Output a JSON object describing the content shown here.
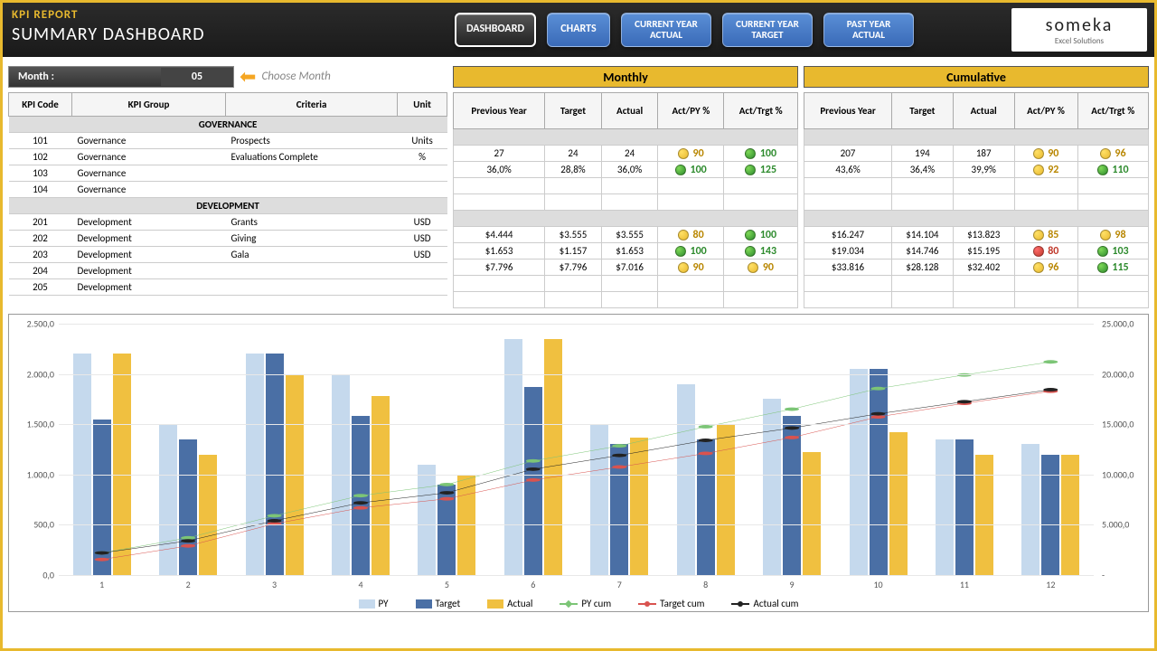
{
  "header": {
    "kpi_label": "KPI REPORT",
    "title": "SUMMARY DASHBOARD",
    "nav": {
      "dashboard": "DASHBOARD",
      "charts": "CHARTS",
      "cy_actual_l1": "CURRENT YEAR",
      "cy_actual_l2": "ACTUAL",
      "cy_target_l1": "CURRENT YEAR",
      "cy_target_l2": "TARGET",
      "py_actual_l1": "PAST YEAR",
      "py_actual_l2": "ACTUAL"
    },
    "logo": "someka",
    "logo_sub": "Excel Solutions"
  },
  "month": {
    "label": "Month :",
    "value": "05",
    "hint": "Choose Month"
  },
  "left_headers": {
    "code": "KPI Code",
    "group": "KPI Group",
    "criteria": "Criteria",
    "unit": "Unit"
  },
  "groups": {
    "gov": "GOVERNANCE",
    "dev": "DEVELOPMENT"
  },
  "rows_gov": [
    {
      "code": "101",
      "group": "Governance",
      "criteria": "Prospects",
      "unit": "Units"
    },
    {
      "code": "102",
      "group": "Governance",
      "criteria": "Evaluations Complete",
      "unit": "%"
    },
    {
      "code": "103",
      "group": "Governance",
      "criteria": "",
      "unit": ""
    },
    {
      "code": "104",
      "group": "Governance",
      "criteria": "",
      "unit": ""
    }
  ],
  "rows_dev": [
    {
      "code": "201",
      "group": "Development",
      "criteria": "Grants",
      "unit": "USD"
    },
    {
      "code": "202",
      "group": "Development",
      "criteria": "Giving",
      "unit": "USD"
    },
    {
      "code": "203",
      "group": "Development",
      "criteria": "Gala",
      "unit": "USD"
    },
    {
      "code": "204",
      "group": "Development",
      "criteria": "",
      "unit": ""
    },
    {
      "code": "205",
      "group": "Development",
      "criteria": "",
      "unit": ""
    }
  ],
  "section_titles": {
    "monthly": "Monthly",
    "cumulative": "Cumulative"
  },
  "val_headers": {
    "py": "Previous Year",
    "target": "Target",
    "actual": "Actual",
    "act_py": "Act/PY %",
    "act_tgt": "Act/Trgt %"
  },
  "monthly_gov": [
    {
      "py": "27",
      "target": "24",
      "actual": "24",
      "act_py": "90",
      "act_py_c": "yellow",
      "act_tgt": "100",
      "act_tgt_c": "green"
    },
    {
      "py": "36,0%",
      "target": "28,8%",
      "actual": "36,0%",
      "act_py": "100",
      "act_py_c": "green",
      "act_tgt": "125",
      "act_tgt_c": "green"
    },
    {
      "py": "",
      "target": "",
      "actual": "",
      "act_py": "",
      "act_tgt": ""
    },
    {
      "py": "",
      "target": "",
      "actual": "",
      "act_py": "",
      "act_tgt": ""
    }
  ],
  "monthly_dev": [
    {
      "py": "$4.444",
      "target": "$3.555",
      "actual": "$3.555",
      "act_py": "80",
      "act_py_c": "yellow",
      "act_tgt": "100",
      "act_tgt_c": "green"
    },
    {
      "py": "$1.653",
      "target": "$1.157",
      "actual": "$1.653",
      "act_py": "100",
      "act_py_c": "green",
      "act_tgt": "143",
      "act_tgt_c": "green"
    },
    {
      "py": "$7.796",
      "target": "$7.796",
      "actual": "$7.016",
      "act_py": "90",
      "act_py_c": "yellow",
      "act_tgt": "90",
      "act_tgt_c": "yellow"
    },
    {
      "py": "",
      "target": "",
      "actual": "",
      "act_py": "",
      "act_tgt": ""
    },
    {
      "py": "",
      "target": "",
      "actual": "",
      "act_py": "",
      "act_tgt": ""
    }
  ],
  "cumulative_gov": [
    {
      "py": "207",
      "target": "194",
      "actual": "187",
      "act_py": "90",
      "act_py_c": "yellow",
      "act_tgt": "96",
      "act_tgt_c": "yellow"
    },
    {
      "py": "43,6%",
      "target": "36,4%",
      "actual": "39,9%",
      "act_py": "92",
      "act_py_c": "yellow",
      "act_tgt": "110",
      "act_tgt_c": "green"
    },
    {
      "py": "",
      "target": "",
      "actual": "",
      "act_py": "",
      "act_tgt": ""
    },
    {
      "py": "",
      "target": "",
      "actual": "",
      "act_py": "",
      "act_tgt": ""
    }
  ],
  "cumulative_dev": [
    {
      "py": "$16.247",
      "target": "$14.104",
      "actual": "$13.823",
      "act_py": "85",
      "act_py_c": "yellow",
      "act_tgt": "98",
      "act_tgt_c": "yellow"
    },
    {
      "py": "$19.034",
      "target": "$14.746",
      "actual": "$15.195",
      "act_py": "80",
      "act_py_c": "red",
      "act_tgt": "103",
      "act_tgt_c": "green"
    },
    {
      "py": "$33.816",
      "target": "$28.128",
      "actual": "$32.402",
      "act_py": "96",
      "act_py_c": "yellow",
      "act_tgt": "115",
      "act_tgt_c": "green"
    },
    {
      "py": "",
      "target": "",
      "actual": "",
      "act_py": "",
      "act_tgt": ""
    },
    {
      "py": "",
      "target": "",
      "actual": "",
      "act_py": "",
      "act_tgt": ""
    }
  ],
  "chart_data": {
    "type": "bar+line",
    "categories": [
      "1",
      "2",
      "3",
      "4",
      "5",
      "6",
      "7",
      "8",
      "9",
      "10",
      "11",
      "12"
    ],
    "y_left_ticks": [
      "0,0",
      "500,0",
      "1.000,0",
      "1.500,0",
      "2.000,0",
      "2.500,0"
    ],
    "y_right_ticks": [
      "-",
      "5.000,0",
      "10.000,0",
      "15.000,0",
      "20.000,0",
      "25.000,0"
    ],
    "ylim_left": [
      0,
      2500
    ],
    "ylim_right": [
      0,
      25000
    ],
    "series_bars": [
      {
        "name": "PY",
        "color": "#c5d9ed",
        "values": [
          2200,
          1500,
          2200,
          2000,
          1100,
          2350,
          1500,
          1900,
          1750,
          2050,
          1350,
          1300
        ]
      },
      {
        "name": "Target",
        "color": "#4a6fa5",
        "values": [
          1550,
          1350,
          2200,
          1580,
          900,
          1870,
          1300,
          1350,
          1580,
          2050,
          1350,
          1200
        ]
      },
      {
        "name": "Actual",
        "color": "#f0c040",
        "values": [
          2200,
          1200,
          2000,
          1780,
          1000,
          2350,
          1370,
          1500,
          1220,
          1420,
          1200,
          1200
        ]
      }
    ],
    "series_lines": [
      {
        "name": "PY cum",
        "color": "#7cc576",
        "marker": "diamond",
        "values": [
          2200,
          3700,
          5900,
          7900,
          9000,
          11350,
          12850,
          14750,
          16500,
          18550,
          19900,
          21200
        ]
      },
      {
        "name": "Target cum",
        "color": "#d9534f",
        "marker": "circle",
        "values": [
          1550,
          2900,
          5100,
          6680,
          7580,
          9450,
          10750,
          12100,
          13680,
          15730,
          17080,
          18280
        ]
      },
      {
        "name": "Actual cum",
        "color": "#222222",
        "marker": "circle",
        "values": [
          2200,
          3400,
          5400,
          7180,
          8180,
          10530,
          11900,
          13400,
          14620,
          16040,
          17240,
          18440
        ]
      }
    ],
    "legend": {
      "py": "PY",
      "target": "Target",
      "actual": "Actual",
      "py_cum": "PY cum",
      "target_cum": "Target cum",
      "actual_cum": "Actual cum"
    }
  }
}
